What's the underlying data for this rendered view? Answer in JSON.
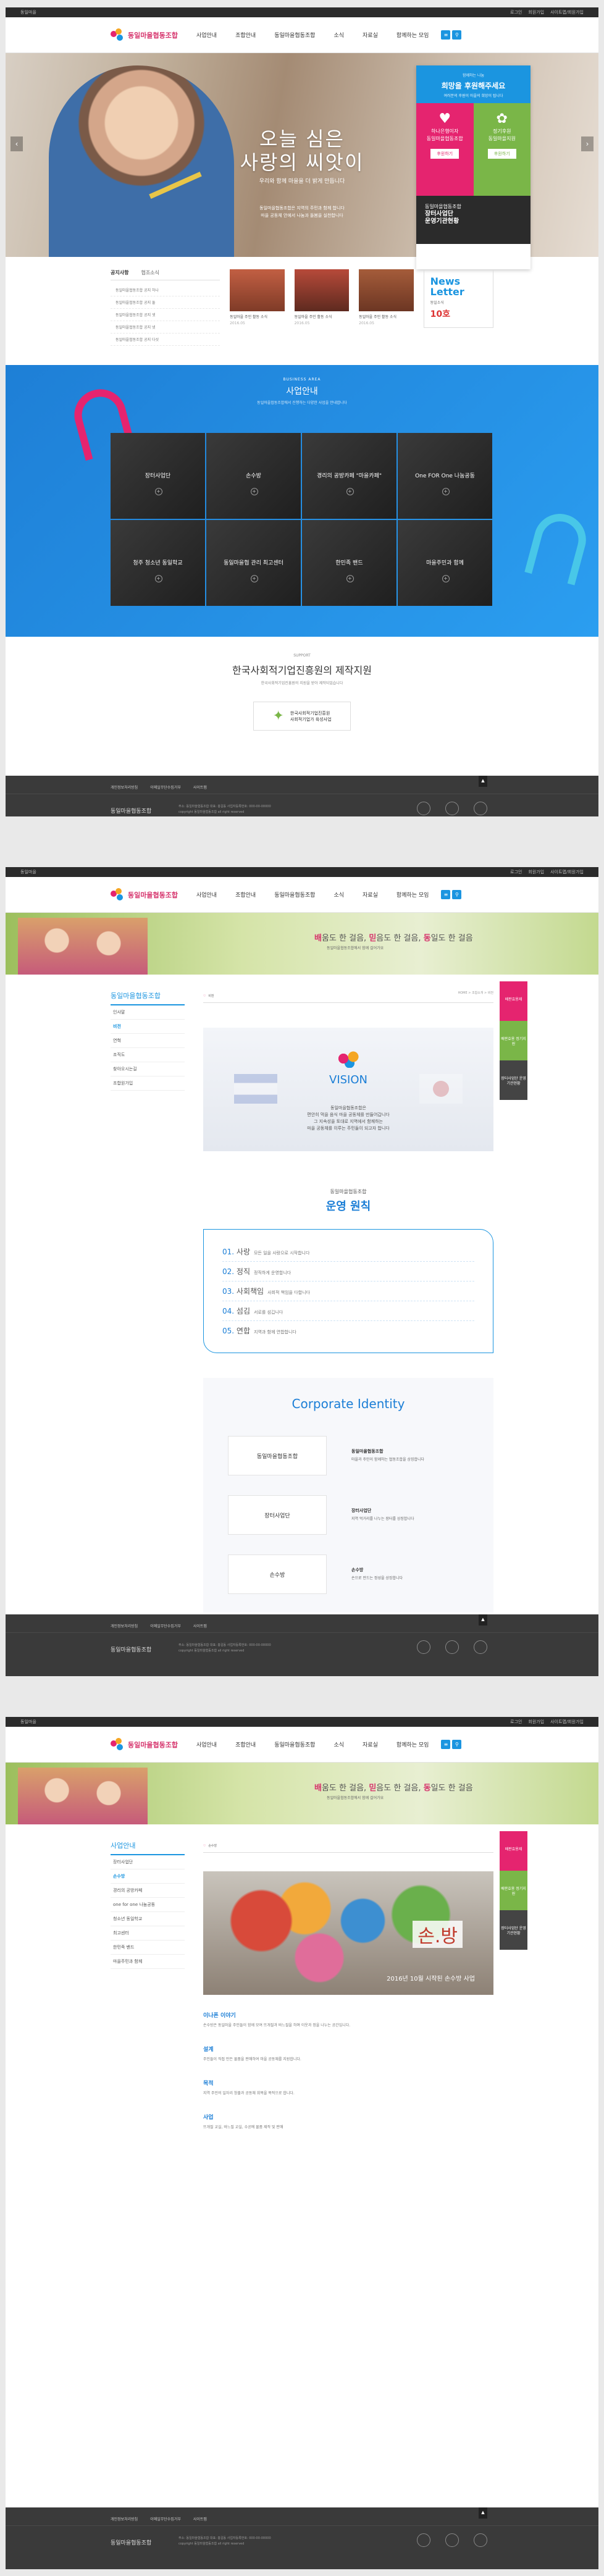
{
  "top": {
    "left": "동일마을",
    "right": [
      "로그인",
      "회원가입",
      "사이트맵/회원가입"
    ]
  },
  "logo": "동일마을협동조합",
  "nav": [
    "사업안내",
    "조합안내",
    "동일마을협동조합",
    "소식",
    "자료실",
    "함께하는 모임"
  ],
  "hero": {
    "title1": "오늘 심은",
    "title2": "사랑의 씨앗이",
    "sub": "우리와 함께 마을을 더 밝게 만듭니다",
    "desc1": "동일마을협동조합은 지역의 주민과 함께 합니다",
    "desc2": "마을 공동체 안에서 나눔과 돌봄을 실천합니다"
  },
  "donate": {
    "top": "함께하는 나눔",
    "title": "희망을 후원해주세요",
    "sub": "여러분의 후원이 마을의 희망이 됩니다",
    "card1": [
      "하나은행이자",
      "동일마을협동조합"
    ],
    "card2": [
      "정기후원",
      "동일마을지원"
    ],
    "btn1": "후원하기",
    "btn2": "후원하기",
    "rep1": "동일마을협동조합",
    "rep2": "장터사업단",
    "rep3": "운영기관현황"
  },
  "news": {
    "tab1": "공지사항",
    "tab2": "협조소식",
    "items": [
      "동일마을협동조합 공지 하나",
      "동일마을협동조합 공지 둘",
      "동일마을협동조합 공지 셋",
      "동일마을협동조합 공지 넷",
      "동일마을협동조합 공지 다섯"
    ],
    "thumbs": [
      {
        "t": "동일마을 주민 활동 소식",
        "d": "2016.05"
      },
      {
        "t": "동일마을 주민 활동 소식",
        "d": "2016.05"
      },
      {
        "t": "동일마을 주민 활동 소식",
        "d": "2016.05"
      }
    ],
    "nl1": "News",
    "nl2": "Letter",
    "nl3": "동일소식",
    "nl4": "10호"
  },
  "biz": {
    "en": "BUSINESS AREA",
    "title": "사업안내",
    "desc": "동일마을협동조합에서 진행하는 다양한 사업을 안내합니다",
    "items": [
      "장터사업단",
      "손수방",
      "경리의 공방카페 \"마을카페\"",
      "One FOR One 나눔공동",
      "청주 청소년 동일학교",
      "동일마을협 관리 최고센터",
      "한민족 밴드",
      "마을주민과 함께"
    ]
  },
  "support": {
    "en": "SUPPORT",
    "title": "한국사회적기업진흥원의 제작지원",
    "desc": "한국사회적기업진흥원의 지원을 받아 제작되었습니다",
    "l1": "한국사회적기업진흥원",
    "l2": "사회적기업가 육성사업"
  },
  "footer": {
    "links": [
      "개인정보처리방침",
      "이메일무단수집거부",
      "사이트맵"
    ],
    "name": "동일마을협동조합",
    "addr": "주소: 동일마을협동조합 대표: 홍길동 사업자등록번호: 000-00-00000",
    "copy": "copyright 동일마을협동조합 all right reserved"
  },
  "slogan": {
    "a": "배",
    "b": "움도 한 걸음, ",
    "c": "믿",
    "d": "음도 한 걸음, ",
    "e": "동",
    "f": "일도 한 걸음",
    "sub": "동일마을협동조합에서 함께 걸어가요"
  },
  "p2": {
    "side": "동일마을협동조합",
    "menu": [
      "인사말",
      "비전",
      "연혁",
      "조직도",
      "찾아오시는길",
      "조합원가입"
    ],
    "title": "비전",
    "crumb": "HOME > 조합소개 > 비전",
    "vision": "VISION",
    "vdesc": [
      "동일마을협동조합은",
      "편안히 먹을 음식 마을 공동체를 만들어갑니다",
      "그 지속성을 토대로 지역에서 함께하는",
      "마을 공동체를 이루는 주민들이 되고자 합니다"
    ],
    "psub": "동일마을협동조합",
    "ptitle": "운영 원칙",
    "pr": [
      [
        "01.",
        "사랑",
        "모든 일을 사랑으로 시작합니다"
      ],
      [
        "02.",
        "정직",
        "정직하게 운영합니다"
      ],
      [
        "03.",
        "사회책임",
        "사회적 책임을 다합니다"
      ],
      [
        "04.",
        "섬김",
        "서로를 섬깁니다"
      ],
      [
        "05.",
        "연합",
        "지역과 함께 연합합니다"
      ]
    ],
    "ci": "Corporate Identity",
    "cis": [
      {
        "box": "동일마을협동조합",
        "t": "동일마을협동조합",
        "d": "마을과 주민이 함께하는 협동조합을 상징합니다"
      },
      {
        "box": "장터사업단",
        "t": "장터사업단",
        "d": "지역 먹거리를 나누는 장터를 상징합니다"
      },
      {
        "box": "손수방",
        "t": "손수방",
        "d": "손으로 만드는 정성을 상징합니다"
      }
    ]
  },
  "quick": [
    "배판효용제",
    "배판효용 정기지원",
    "장터사업단 운영기관현황"
  ],
  "p3": {
    "side": "사업안내",
    "menu": [
      "장터사업단",
      "손수방",
      "경리의 공방카페",
      "one for one 나눔공동",
      "청소년 동일학교",
      "최고센터",
      "한민족 밴드",
      "마을주민과 함께"
    ],
    "title": "손수방",
    "ptitle": "2016년 10월 시작된 손수방 사업",
    "logo": "손.방",
    "secs": [
      {
        "h": "이나폰 이야기",
        "p": "손수방은 동일마을 주민들이 함께 모여 뜨개질과 바느질을 하며 이웃과 정을 나누는 공간입니다."
      },
      {
        "h": "설계",
        "p": "주민들이 직접 만든 물품을 판매하여 마을 공동체를 지원합니다."
      },
      {
        "h": "목적",
        "p": "지역 주민의 일자리 창출과 공동체 회복을 목적으로 합니다."
      },
      {
        "h": "사업",
        "p": "뜨개질 교실, 바느질 교실, 수공예 물품 제작 및 판매"
      }
    ]
  },
  "colors": {
    "blue": "#1b95e0",
    "pink": "#e5246f",
    "green": "#7ab648",
    "dark": "#2b2b2b"
  }
}
